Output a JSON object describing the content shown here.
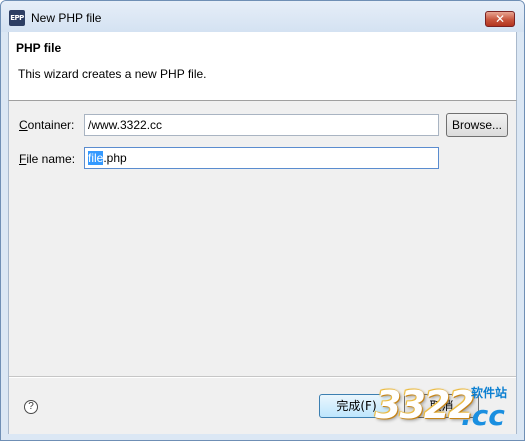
{
  "window": {
    "icon_text": "EPP",
    "title": "New PHP file",
    "close_glyph": "✕"
  },
  "header": {
    "title": "PHP file",
    "description": "This wizard creates a new PHP file."
  },
  "form": {
    "container": {
      "label_mnemonic": "C",
      "label_rest": "ontainer:",
      "value": "/www.3322.cc",
      "browse_label": "Browse..."
    },
    "file_name": {
      "label_mnemonic": "F",
      "label_rest": "ile name:",
      "selected_part": "file",
      "rest_part": ".php"
    }
  },
  "footer": {
    "help_icon": "question-circle",
    "help_glyph": "?",
    "finish_label": "完成(F)",
    "cancel_label": "取消"
  },
  "watermark": {
    "digits": "3322",
    "sub": "软件站",
    "domain": ".cc"
  },
  "colors": {
    "selection": "#3399ff",
    "close_button": "#c8553d",
    "focused_button_border": "#3c7fb1"
  }
}
